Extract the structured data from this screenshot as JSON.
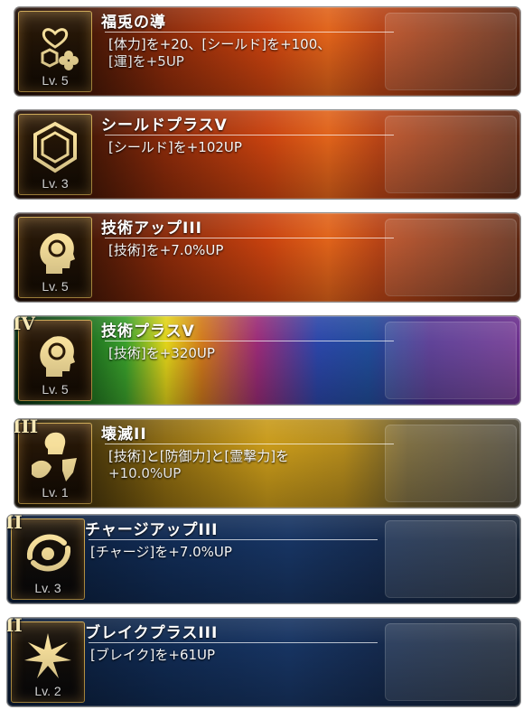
{
  "skills": [
    {
      "title": "福兎の導",
      "desc": "[体力]を+20、[シールド]を+100、\n[運]を+5UP",
      "level": "Lv. 5",
      "rank": "",
      "icon": "rabbit-heart-clover-icon"
    },
    {
      "title": "シールドプラスV",
      "desc": "[シールド]を+102UP",
      "level": "Lv. 3",
      "rank": "",
      "icon": "shield-hexagon-icon"
    },
    {
      "title": "技術アップIII",
      "desc": "[技術]を+7.0%UP",
      "level": "Lv. 5",
      "rank": "",
      "icon": "head-gear-icon"
    },
    {
      "title": "技術プラスV",
      "desc": "[技術]を+320UP",
      "level": "Lv. 5",
      "rank": "IV",
      "icon": "head-gear-icon"
    },
    {
      "title": "壊滅II",
      "desc": "[技術]と[防御力]と[霊撃力]を\n+10.0%UP",
      "level": "Lv. 1",
      "rank": "III",
      "icon": "head-shield-spark-icon"
    },
    {
      "title": "チャージアップIII",
      "desc": "[チャージ]を+7.0%UP",
      "level": "Lv. 3",
      "rank": "II",
      "icon": "swirl-charge-icon"
    },
    {
      "title": "ブレイクプラスIII",
      "desc": "[ブレイク]を+61UP",
      "level": "Lv. 2",
      "rank": "II",
      "icon": "burst-star-icon"
    }
  ],
  "colors": {
    "fire": "#c8420f",
    "gold": "#c89a1a",
    "blue": "#173462",
    "frame": "#c9a24a"
  }
}
